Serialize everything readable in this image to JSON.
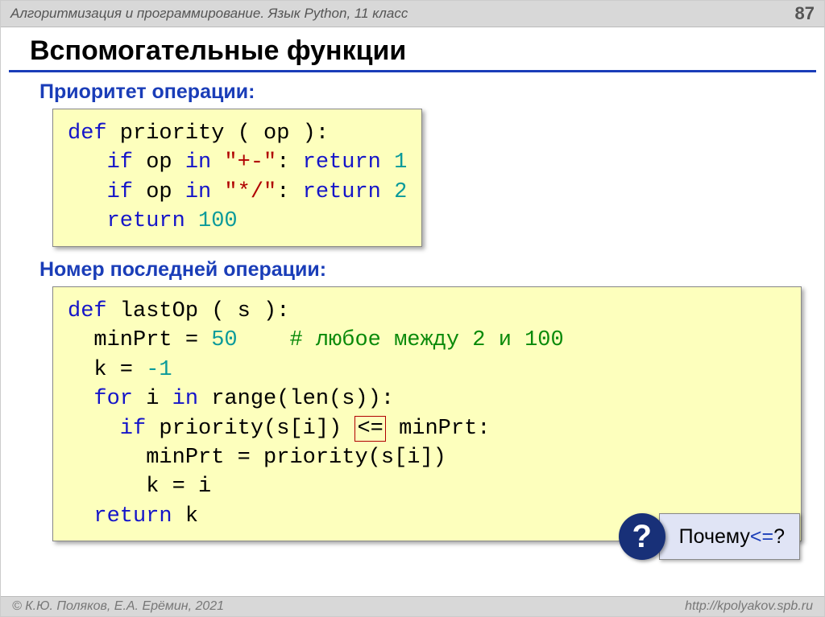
{
  "header": {
    "course": "Алгоритмизация и программирование. Язык Python, 11 класс",
    "page": "87"
  },
  "title": "Вспомогательные функции",
  "section1": {
    "heading": "Приоритет операции:",
    "kw_def": "def",
    "fn": " priority",
    "sig": " ( op ):",
    "kw_if1": "   if",
    "txt_op_in1": " op ",
    "kw_in1": "in",
    "str1": " \"+-\"",
    "colon_ret1": ": ",
    "kw_ret1": "return",
    "num1": " 1",
    "kw_if2": "   if",
    "txt_op_in2": " op ",
    "kw_in2": "in",
    "str2": " \"*/\"",
    "colon_ret2": ": ",
    "kw_ret2": "return",
    "num2": " 2",
    "kw_ret3": "   return",
    "num3": " 100"
  },
  "section2": {
    "heading": "Номер последней операции:",
    "kw_def": "def",
    "fn": " lastOp",
    "sig": " ( s ):",
    "l2a": "  minPrt = ",
    "l2num": "50",
    "l2gap": "    ",
    "l2cmt": "# любое между 2 и 100",
    "l3a": "  k = ",
    "l3num": "-1",
    "kw_for": "  for",
    "l4a": " i ",
    "kw_in": "in",
    "l4b": " range(len(s)):",
    "kw_if": "    if",
    "l5a": " priority(s[i]) ",
    "op_le": "<=",
    "l5b": " minPrt:",
    "l6": "      minPrt = priority(s[i])",
    "l7": "      k = i",
    "kw_ret": "  return",
    "l8b": " k"
  },
  "callout": {
    "mark": "?",
    "text_a": "Почему ",
    "op": "<=",
    "text_b": "?"
  },
  "footer": {
    "left": "© К.Ю. Поляков, Е.А. Ерёмин, 2021",
    "right": "http://kpolyakov.spb.ru"
  }
}
